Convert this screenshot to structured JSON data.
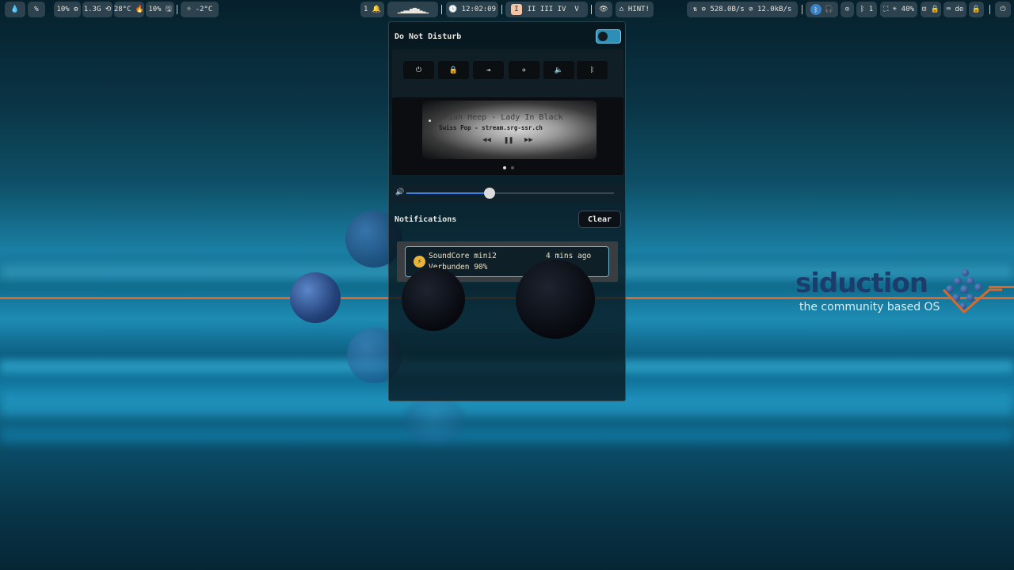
{
  "topbar": {
    "left": [
      {
        "icon": "drop-icon",
        "text": ""
      },
      {
        "icon": "percent-icon",
        "text": "%"
      },
      {
        "icon": "cpu-icon",
        "text": "10% ⚙"
      },
      {
        "icon": "memory-icon",
        "text": "1.3G ⟲"
      },
      {
        "icon": "temperature-icon",
        "text": "28°C 🔥"
      },
      {
        "icon": "disk-icon",
        "text": "10% 🖫"
      },
      {
        "icon": "weather-icon",
        "text": "☼  -2°C"
      }
    ],
    "center": {
      "notifications": "1 🔔",
      "visualizer": "▁▂▃▃▅▆▅▃▂▁",
      "clock": "🕓 12:02:09",
      "workspaces": [
        "I",
        "II",
        "III",
        "IV",
        "V"
      ],
      "active_workspace": "I",
      "idle": "👁",
      "hint": "⌂ HINT!"
    },
    "right": {
      "network": "⇅ ⊖ 528.0B/s  ⊘ 12.0kB/s",
      "bluetooth": "ᛒ",
      "bt_device": "🎧",
      "record": "⊙",
      "bt_count": "ᛒ 1",
      "brightness": "⛶ ☀ 40%",
      "lock_group": "⊡ 🔒",
      "keyboard": "⌨ de",
      "lock": "🔒",
      "power": "⏻"
    }
  },
  "logo": {
    "name": "siduction",
    "tagline": "the community based OS"
  },
  "panel": {
    "dnd_label": "Do Not Disturb",
    "actions": [
      {
        "name": "power-icon",
        "glyph": "⏻"
      },
      {
        "name": "lock-icon",
        "glyph": "🔒"
      },
      {
        "name": "logout-icon",
        "glyph": "⇥"
      },
      {
        "name": "airplane-icon",
        "glyph": "✈"
      },
      {
        "name": "mute-icon",
        "glyph": "🔈"
      },
      {
        "name": "bluetooth-icon",
        "glyph": "ᛒ"
      }
    ],
    "media": {
      "title": "Uriah Heep - Lady In Black",
      "subtitle": "Swiss Pop - stream.srg-ssr.ch",
      "prev": "◀◀",
      "pause": "❚❚",
      "next": "▶▶"
    },
    "volume_icon": "🔊",
    "volume_level": 0.4,
    "notifications_label": "Notifications",
    "clear_label": "Clear",
    "notification": {
      "title": "SoundCore mini2",
      "body": "Verbunden 90%",
      "time": "4 mins ago",
      "icon": "⚡"
    }
  },
  "colors": {
    "accent": "#3d7fe0",
    "toggle": "#2d8fb5",
    "orange": "#d9692a",
    "notif_border": "#66b9d8"
  }
}
